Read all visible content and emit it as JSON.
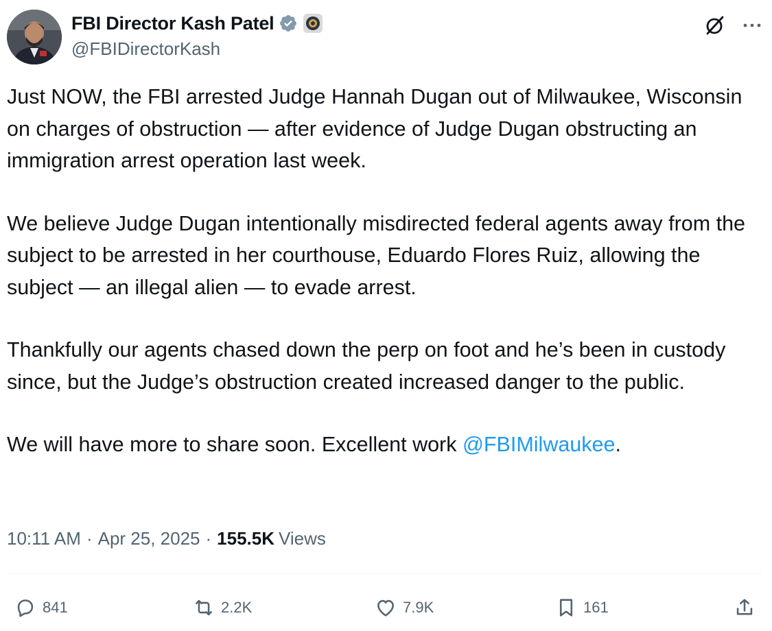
{
  "author": {
    "display_name": "FBI Director Kash Patel",
    "handle": "@FBIDirectorKash"
  },
  "tweet": {
    "paragraphs": [
      "Just NOW, the FBI arrested Judge Hannah Dugan out of Milwaukee, Wisconsin on charges of obstruction — after evidence of Judge Dugan obstructing an immigration arrest operation last week.",
      "We believe Judge Dugan intentionally misdirected federal agents away from the subject to be arrested in her courthouse, Eduardo Flores Ruiz, allowing the subject — an illegal alien — to evade arrest.",
      "Thankfully our agents chased down the perp on foot and he’s been in custody since, but the Judge’s obstruction created increased danger to the public."
    ],
    "last_paragraph_prefix": "We will have more to share soon. Excellent work ",
    "mention": "@FBIMilwaukee",
    "last_paragraph_suffix": "."
  },
  "meta": {
    "time": "10:11 AM",
    "separator": "·",
    "date": "Apr 25, 2025",
    "views_count": "155.5K",
    "views_label": "Views"
  },
  "actions": {
    "replies": "841",
    "reposts": "2.2K",
    "likes": "7.9K",
    "bookmarks": "161"
  },
  "icons": {
    "verified": "verified-badge-icon",
    "affiliation": "fbi-seal-icon",
    "grok": "grok-icon",
    "more": "more-dots-icon",
    "reply": "reply-bubble-icon",
    "repost": "repost-arrows-icon",
    "like": "heart-icon",
    "bookmark": "bookmark-icon",
    "share": "share-upload-icon"
  },
  "colors": {
    "text": "#0f1419",
    "secondary": "#536471",
    "link": "#1d9bf0",
    "verified": "#829aab",
    "divider": "#eff3f4"
  }
}
